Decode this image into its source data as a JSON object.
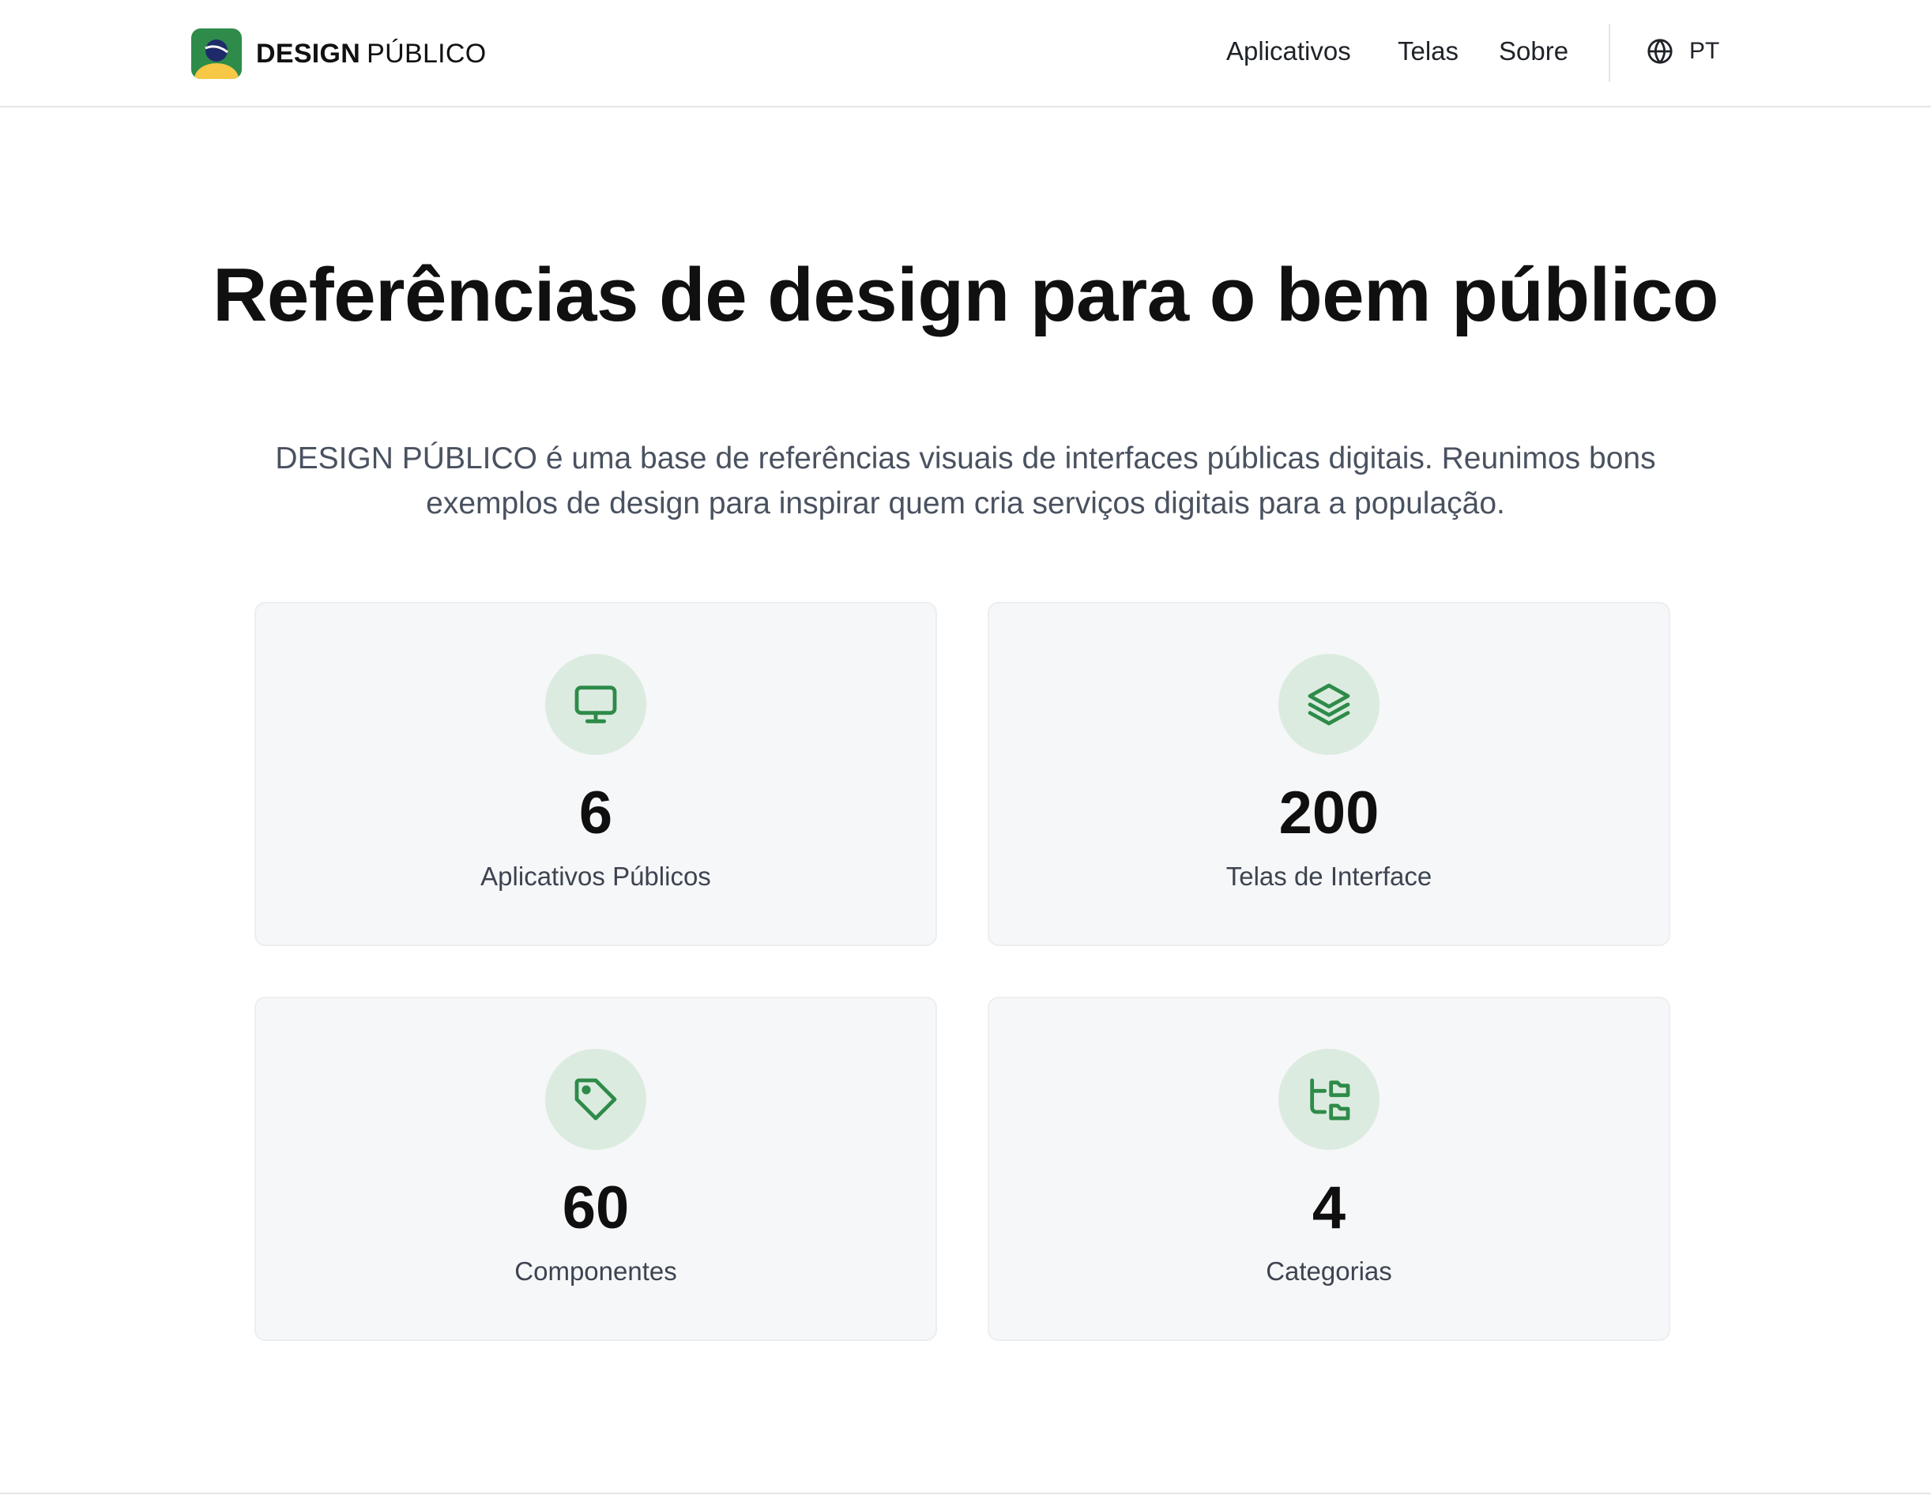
{
  "brand": {
    "name_bold": "DESIGN",
    "name_light": "PÚBLICO",
    "logo_icon": "brazil-flag-logo-icon",
    "logo_colors": {
      "green": "#2e8b4a",
      "yellow": "#f7c845",
      "blue": "#1f2a6b"
    }
  },
  "nav": {
    "items": [
      {
        "label": "Aplicativos"
      },
      {
        "label": "Telas"
      },
      {
        "label": "Sobre"
      }
    ],
    "language": {
      "icon": "globe-icon",
      "label": "PT"
    }
  },
  "hero": {
    "title": "Referências de design para o bem público",
    "subtitle": "DESIGN PÚBLICO é uma base de referências visuais de interfaces públicas digitais. Reunimos bons exemplos de design para inspirar quem cria serviços digitais para a população."
  },
  "stats": [
    {
      "icon": "monitor-icon",
      "value": "6",
      "label": "Aplicativos Públicos"
    },
    {
      "icon": "layers-icon",
      "value": "200",
      "label": "Telas de Interface"
    },
    {
      "icon": "tag-icon",
      "value": "60",
      "label": "Componentes"
    },
    {
      "icon": "folder-tree-icon",
      "value": "4",
      "label": "Categorias"
    }
  ],
  "colors": {
    "accent": "#2e8b4a",
    "icon_bg": "#dcebdf",
    "card_bg": "#f6f7f9",
    "text": "#111111",
    "muted": "#4a5260"
  }
}
